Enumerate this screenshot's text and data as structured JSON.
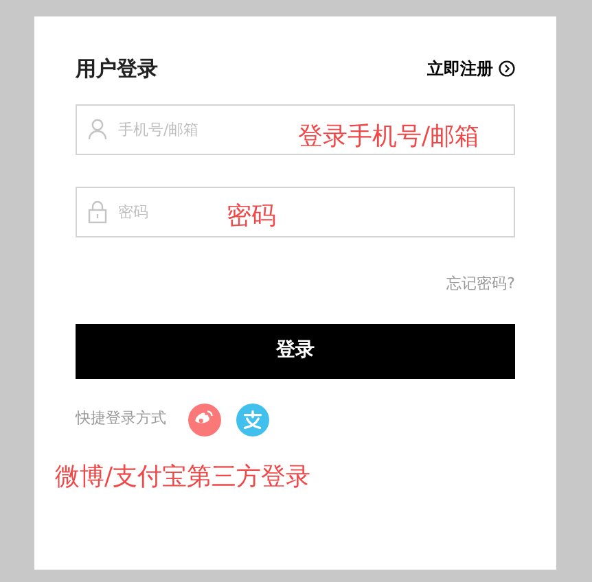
{
  "title": "用户登录",
  "register_link": "立即注册",
  "fields": [
    {
      "kind": "user",
      "placeholder": "手机号/邮箱"
    },
    {
      "kind": "password",
      "placeholder": "密码"
    }
  ],
  "forgot_link": "忘记密码?",
  "login_button": "登录",
  "quick_login": {
    "label": "快捷登录方式",
    "providers": [
      {
        "kind": "weibo",
        "color": "#fb7878"
      },
      {
        "kind": "alipay",
        "color": "#41c0ee"
      }
    ]
  },
  "annotations": [
    "登录手机号/邮箱",
    "密码",
    "微博/支付宝第三方登录"
  ]
}
